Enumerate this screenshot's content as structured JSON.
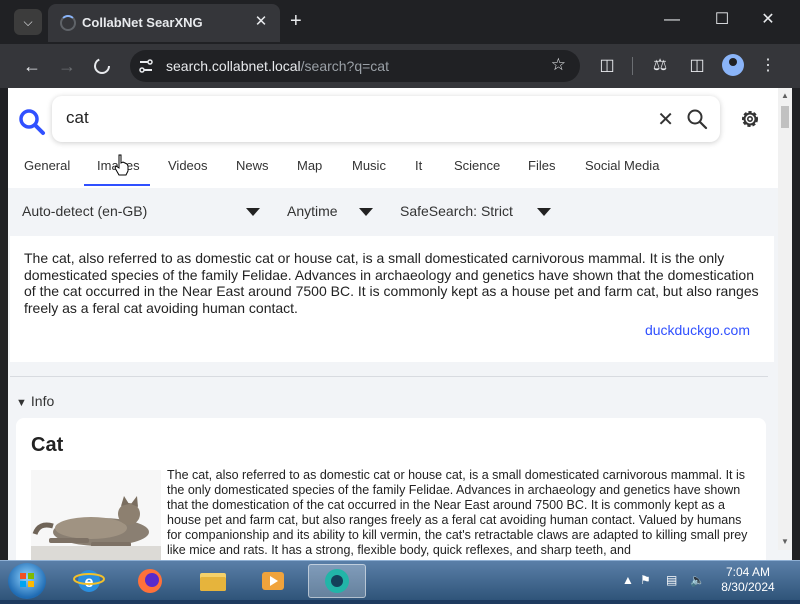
{
  "browser": {
    "tab_title": "CollabNet SearXNG",
    "url_host": "search.collabnet.local",
    "url_path": "/search?q=cat",
    "tab_close": "✕",
    "new_tab": "+",
    "minimize": "—",
    "maximize": "☐",
    "close": "✕"
  },
  "search": {
    "query": "cat",
    "clear": "✕"
  },
  "categories": [
    "General",
    "Images",
    "Videos",
    "News",
    "Map",
    "Music",
    "It",
    "Science",
    "Files",
    "Social Media"
  ],
  "active_category": "Images",
  "filters": {
    "language": "Auto-detect (en-GB)",
    "time": "Anytime",
    "safesearch": "SafeSearch: Strict"
  },
  "answer": {
    "text": "The cat, also referred to as domestic cat or house cat, is a small domesticated carnivorous mammal. It is the only domesticated species of the family Felidae. Advances in archaeology and genetics have shown that the domestication of the cat occurred in the Near East around 7500 BC. It is commonly kept as a house pet and farm cat, but also ranges freely as a feral cat avoiding human contact.",
    "source": "duckduckgo.com"
  },
  "info": {
    "header": "Info",
    "title": "Cat",
    "text": "The cat, also referred to as domestic cat or house cat, is a small domesticated carnivorous mammal. It is the only domesticated species of the family Felidae. Advances in archaeology and genetics have shown that the domestication of the cat occurred in the Near East around 7500 BC. It is commonly kept as a house pet and farm cat, but also ranges freely as a feral cat avoiding human contact. Valued by humans for companionship and its ability to kill vermin, the cat's retractable claws are adapted to killing small prey like mice and rats. It has a strong, flexible body, quick reflexes, and sharp teeth, and"
  },
  "taskbar": {
    "time": "7:04 AM",
    "date": "8/30/2024"
  },
  "colors": {
    "accent": "#3050ff",
    "chrome_dark": "#202124"
  }
}
